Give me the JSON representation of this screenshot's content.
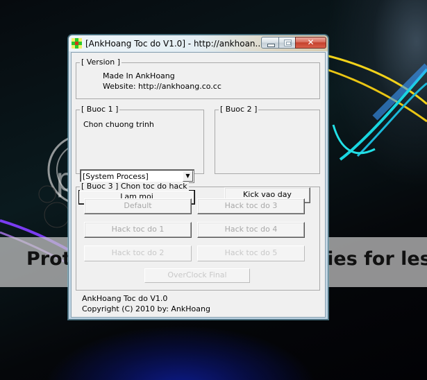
{
  "window": {
    "title": "[AnkHoang Toc do V1.0] - http://ankhoan...",
    "controls": {
      "minimize": "minimize",
      "maximize": "maximize",
      "close": "✕"
    }
  },
  "version_group": {
    "legend": "[ Version ]",
    "line1": "Made In AnkHoang",
    "line2": "Website: http://ankhoang.co.cc"
  },
  "step1": {
    "legend": "[ Buoc 1 ]",
    "label": "Chon chuong trinh",
    "process_select": {
      "value": "[System Process]"
    },
    "refresh_button": "Lam moi"
  },
  "step2": {
    "legend": "[ Buoc 2 ]",
    "kick_button": "Kick vao day"
  },
  "step3": {
    "legend": "[ Buoc 3 ] Chon toc do hack",
    "buttons": [
      {
        "label": "Default",
        "enabled": false
      },
      {
        "label": "Hack toc do 3",
        "enabled": false
      },
      {
        "label": "Hack toc do 1",
        "enabled": false
      },
      {
        "label": "Hack toc do 4",
        "enabled": false
      },
      {
        "label": "Hack toc do 2",
        "enabled": false
      },
      {
        "label": "Hack toc do 5",
        "enabled": false
      },
      {
        "label": "OverClock Final",
        "enabled": false
      }
    ]
  },
  "footer": {
    "line1": "AnkHoang Toc do V1.0",
    "line2": "Copyright (C) 2010 by: AnkHoang"
  },
  "watermark": {
    "logo": "photobucket",
    "banner": "Protect more of your memories for less!"
  },
  "colors": {
    "client_bg": "#f0f0f0",
    "close_red": "#c4402c",
    "desktop_dark": "#05070a"
  }
}
